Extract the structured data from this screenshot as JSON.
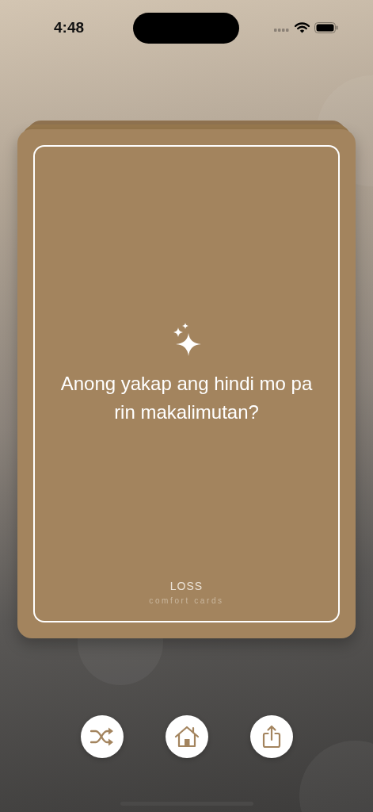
{
  "status_bar": {
    "time": "4:48"
  },
  "card": {
    "question": "Anong yakap ang hindi mo pa rin makalimutan?",
    "category": "LOSS",
    "deck": "comfort cards"
  },
  "actions": [
    {
      "kind": "shuffle"
    },
    {
      "kind": "home"
    },
    {
      "kind": "share"
    }
  ]
}
